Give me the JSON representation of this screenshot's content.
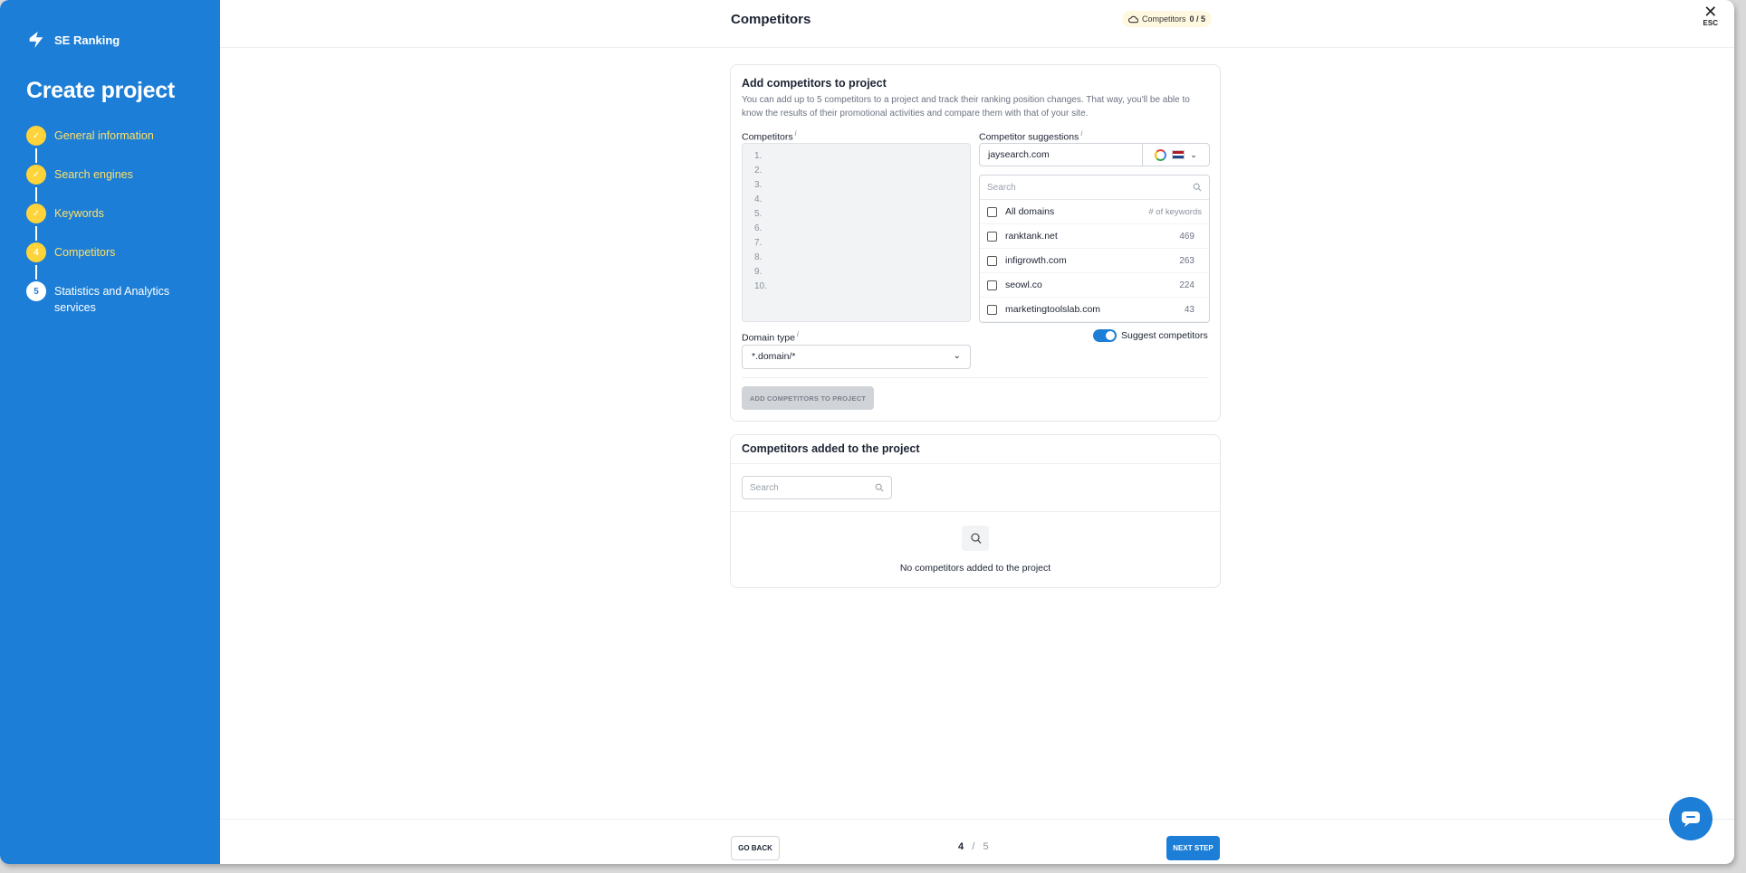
{
  "brand": {
    "name": "SE Ranking"
  },
  "sidebar": {
    "title": "Create project",
    "steps": [
      {
        "marker": "✓",
        "label": "General information",
        "state": "done"
      },
      {
        "marker": "✓",
        "label": "Search engines",
        "state": "done"
      },
      {
        "marker": "✓",
        "label": "Keywords",
        "state": "done"
      },
      {
        "marker": "4",
        "label": "Competitors",
        "state": "current"
      },
      {
        "marker": "5",
        "label": "Statistics and Analytics services",
        "state": "todo"
      }
    ]
  },
  "header": {
    "title": "Competitors",
    "badge_label": "Competitors",
    "badge_count": "0 / 5",
    "close_label": "ESC"
  },
  "add_card": {
    "title": "Add competitors to project",
    "description": "You can add up to 5 competitors to a project and track their ranking position changes. That way, you'll be able to know the results of their promotional activities and compare them with that of your site.",
    "competitors_label": "Competitors",
    "line_numbers": [
      "1.",
      "2.",
      "3.",
      "4.",
      "5.",
      "6.",
      "7.",
      "8.",
      "9.",
      "10."
    ],
    "suggestions_label": "Competitor suggestions",
    "suggestions_domain": "jaysearch.com",
    "search_placeholder": "Search",
    "all_domains_label": "All domains",
    "keywords_header": "# of keywords",
    "suggestions": [
      {
        "domain": "ranktank.net",
        "count": "469"
      },
      {
        "domain": "infigrowth.com",
        "count": "263"
      },
      {
        "domain": "seowl.co",
        "count": "224"
      },
      {
        "domain": "marketingtoolslab.com",
        "count": "43"
      }
    ],
    "domain_type_label": "Domain type",
    "domain_type_value": "*.domain/*",
    "toggle_label": "Suggest competitors",
    "toggle_on": true,
    "add_button": "ADD COMPETITORS TO PROJECT"
  },
  "added_card": {
    "title": "Competitors added to the project",
    "search_placeholder": "Search",
    "empty_text": "No competitors added to the project"
  },
  "footer": {
    "back_button": "GO BACK",
    "current_page": "4",
    "separator": "/",
    "total_pages": "5",
    "next_button": "NEXT STEP"
  },
  "colors": {
    "sidebar_bg": "#1c7ed6",
    "step_done": "#ffd43b",
    "primary": "#1c7ed6"
  }
}
